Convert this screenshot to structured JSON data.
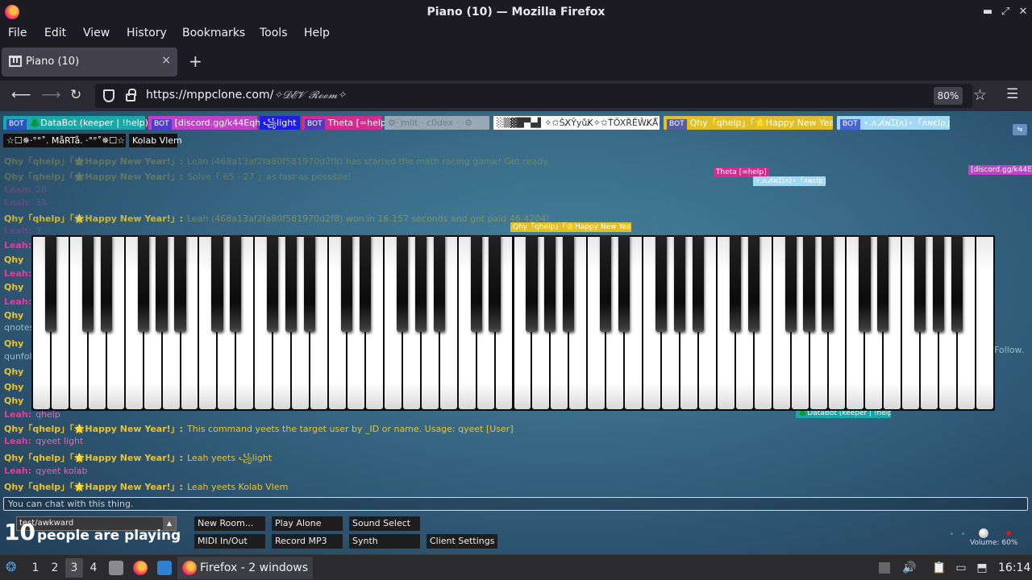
{
  "window": {
    "title": "Piano (10) — Mozilla Firefox"
  },
  "menu": [
    "File",
    "Edit",
    "View",
    "History",
    "Bookmarks",
    "Tools",
    "Help"
  ],
  "tab": {
    "label": "Piano (10)",
    "close": "×",
    "new": "+"
  },
  "nav": {
    "url": "https://mppclone.com/",
    "room_suffix": "✧𝓓𝓔𝓥 𝓡𝓸𝓸𝓶✧",
    "zoom": "80%"
  },
  "users": [
    {
      "bot": "BOT",
      "name": "🌲DataBot (keeper | !help)🌲",
      "bg": "#1aa7a7",
      "fg": "#ffffff"
    },
    {
      "bot": "BOT",
      "name": "[discord.gg/k44Eqha]",
      "bg": "#c042c8",
      "fg": "#ffffff"
    },
    {
      "bot": "",
      "name": "꧁light",
      "bg": "#1d1de6",
      "fg": "#ffffff"
    },
    {
      "bot": "BOT",
      "name": "Theta [=help]",
      "bg": "#d62b8e",
      "fg": "#ffffff"
    },
    {
      "bot": "",
      "name": "⚙·꙰ mllt · c0dex · ·⚙",
      "bg": "#9aa8b5",
      "fg": "#6d7d8b"
    },
    {
      "bot": "",
      "name": "░▒▓█▀▄▌✧✩ŠX̸ŶyůK̸✧✩ŤÖXŘĚŴK̸Ǻ✧✩ ▐▀▄█▓▒░",
      "bg": "#ffffff",
      "fg": "#333333"
    },
    {
      "bot": "BOT",
      "name": "Qhy「qhelp」「🌟Happy New Year!」",
      "bg": "#e2bf25",
      "fg": "#ffffff"
    },
    {
      "bot": "BOT",
      "name": "⋆.ᴧ.ᴧ̸ɴꞮ(ᴧ)⋆「ᴧɴɛlp」",
      "bg": "#9fd9f5",
      "fg": "#ffffff"
    },
    {
      "bot": "",
      "name": "☆☐✵·°°˚. MåRTå. ·°°˚✵☐☆",
      "bg": "#111111",
      "fg": "#ffffff"
    },
    {
      "bot": "",
      "name": "Kolab Vlem",
      "bg": "#111111",
      "fg": "#ffffff"
    }
  ],
  "chat": [
    {
      "user": "Qhy「qhelp」「🌟Happy New Year!」:",
      "text": "Leah (468a13af2fa80f581970d2f8) has started the math racing game! Get ready.",
      "kind": "qhy",
      "dim": true
    },
    {
      "user": "Qhy「qhelp」「🌟Happy New Year!」:",
      "text": "Solve「 65 - 27 」as fast as possible!",
      "kind": "qhy",
      "dim": true
    },
    {
      "user": "Leah:",
      "text": "28",
      "kind": "leah",
      "dim": true
    },
    {
      "user": "Leah:",
      "text": "38",
      "kind": "leah",
      "dim": true
    },
    {
      "user": "Qhy「qhelp」「🌟Happy New Year!」:",
      "text": "Leah (468a13af2fa80f581970d2f8) won in 16.157 seconds and got paid 46.4204!",
      "kind": "qhy",
      "dim": true
    },
    {
      "user": "Leah:",
      "text": "3",
      "kind": "leah",
      "dim": true
    },
    {
      "user": "Qhy「qhelp」「🌟Happy New Year!」:",
      "text": "This command yeets the target user by _ID or name. Usage: qyeet [User]",
      "kind": "qhy",
      "dim": false
    },
    {
      "user": "Leah:",
      "text": "qyeet light",
      "kind": "leah",
      "dim": false
    },
    {
      "user": "Qhy「qhelp」「🌟Happy New Year!」:",
      "text": "Leah yeets ꧁light",
      "kind": "qhy",
      "dim": false
    },
    {
      "user": "Leah:",
      "text": "qyeet kolab",
      "kind": "leah",
      "dim": false
    },
    {
      "user": "Qhy「qhelp」「🌟Happy New Year!」:",
      "text": "Leah yeets Kolab Vlem",
      "kind": "qhy",
      "dim": false
    }
  ],
  "chat_partial": [
    "qnotes",
    "qunfol",
    "Follow.",
    "qhelp"
  ],
  "cursors": [
    {
      "label": "Theta [=help]",
      "bg": "#d62b8e",
      "fg": "#ffffff"
    },
    {
      "label": "⋆.ᴧ.ᴧ̸ɴꞮ(ᴧ)⋆「ᴧɴɛlp」",
      "bg": "#9fd9f5",
      "fg": "#ffffff"
    },
    {
      "label": "[discord.gg/k44Eqha]",
      "bg": "#c042c8",
      "fg": "#ffffff"
    },
    {
      "label": "Qhy「qhelp」「🌟Happy New Year!」",
      "bg": "#e2bf25",
      "fg": "#ffffff"
    },
    {
      "label": "🌲DataBot (keeper | !help)🌲",
      "bg": "#1aa7a7",
      "fg": "#ffffff"
    }
  ],
  "chat_input": {
    "placeholder": "You can chat with this thing."
  },
  "room": {
    "name": "test/awkward",
    "arrow": "▲"
  },
  "people": {
    "count": "10",
    "label": "people are playing"
  },
  "controls": [
    "New Room...",
    "Play Alone",
    "Sound Select",
    "MIDI In/Out",
    "Record MP3",
    "Synth",
    "Client Settings"
  ],
  "volume": {
    "label": "Volume: 60%",
    "level": 0.6
  },
  "taskbar": {
    "workspaces": [
      "1",
      "2",
      "3",
      "4"
    ],
    "active_workspace": "3",
    "app_label": "Firefox - 2 windows",
    "clock": "16:14"
  }
}
